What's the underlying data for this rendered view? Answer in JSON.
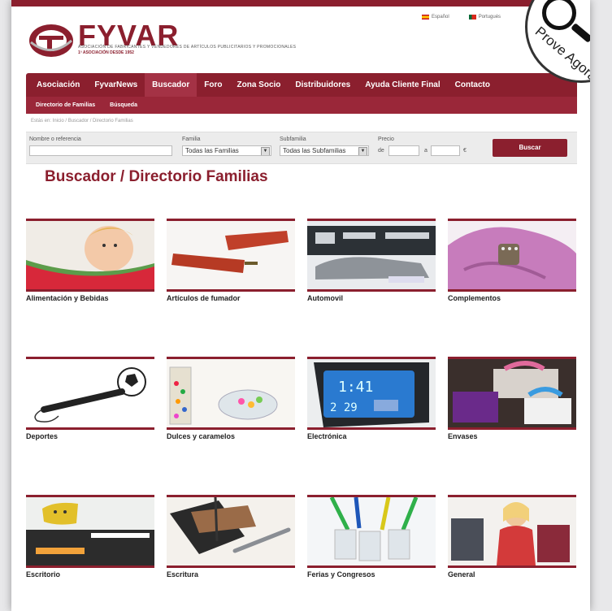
{
  "header": {
    "brand": "FYVAR",
    "tagline": "ASOCIACIÓN DE FABRICANTES Y VENDEDORES DE ARTÍCULOS PUBLICITARIOS Y PROMOCIONALES",
    "tagline2": "1ª ASOCIACIÓN DESDE 1952",
    "languages": [
      "Español",
      "Portugués"
    ]
  },
  "nav": {
    "items": [
      "Asociación",
      "FyvarNews",
      "Buscador",
      "Foro",
      "Zona Socio",
      "Distribuidores",
      "Ayuda Cliente Final",
      "Contacto"
    ],
    "active_index": 2,
    "subitems": [
      "Directorio de Familias",
      "Búsqueda"
    ]
  },
  "breadcrumb": "Estás en: Inicio / Buscador / Directorio Familias",
  "search": {
    "ref_label": "Nombre o referencia",
    "ref_value": "",
    "familia_label": "Familia",
    "familia_value": "Todas las Familias",
    "subfamilia_label": "Subfamilia",
    "subfamilia_value": "Todas las Subfamilias",
    "precio_label": "Precio",
    "de_label": "de",
    "a_label": "a",
    "currency": "€",
    "button_label": "Buscar"
  },
  "page_title": "Buscador / Directorio Familias",
  "families": [
    "Alimentación y Bebidas",
    "Artículos de fumador",
    "Automovil",
    "Complementos",
    "Deportes",
    "Dulces y caramelos",
    "Electrónica",
    "Envases",
    "Escritorio",
    "Escritura",
    "Ferias y Congresos",
    "General"
  ],
  "badge_text": "Prove Agora",
  "colors": {
    "brand": "#8b1f2e"
  }
}
